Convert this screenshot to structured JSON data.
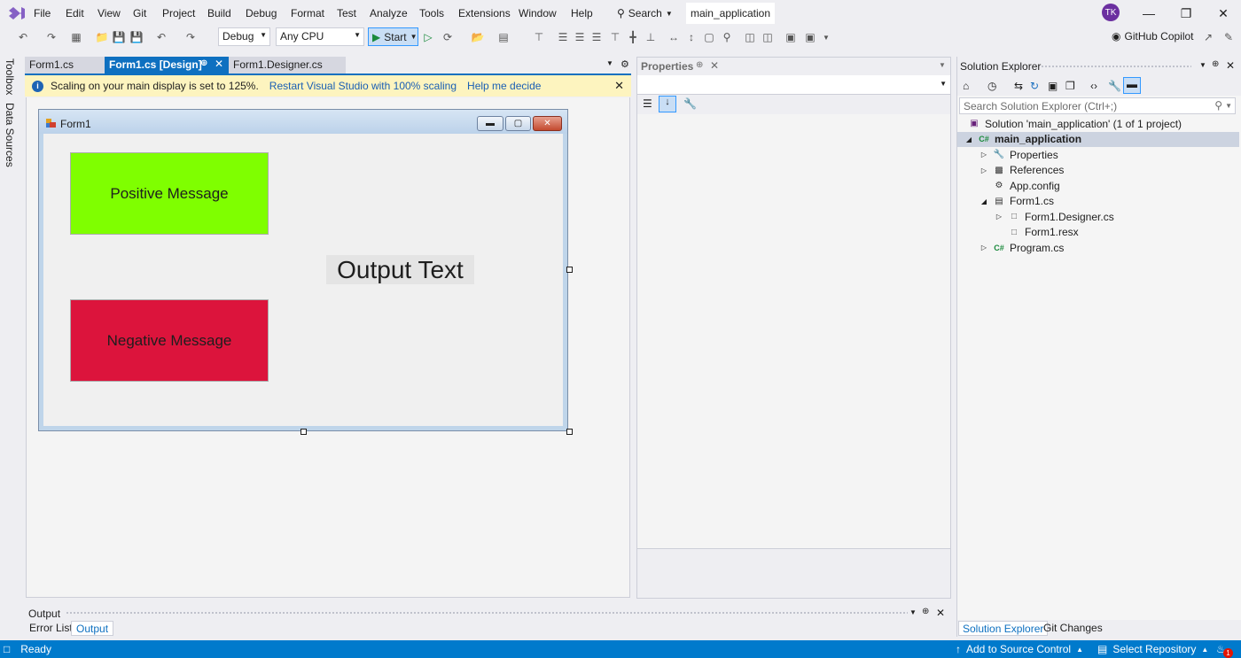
{
  "menu": {
    "items": [
      "File",
      "Edit",
      "View",
      "Git",
      "Project",
      "Build",
      "Debug",
      "Format",
      "Test",
      "Analyze",
      "Tools",
      "Extensions",
      "Window",
      "Help"
    ],
    "search_label": "Search",
    "solution_name": "main_application",
    "avatar_initials": "TK"
  },
  "toolbar": {
    "config": "Debug",
    "platform": "Any CPU",
    "start_label": "Start",
    "copilot_label": "GitHub Copilot"
  },
  "sidebar": {
    "toolbox": "Toolbox",
    "data_sources": "Data Sources"
  },
  "doc_tabs": [
    {
      "label": "Form1.cs",
      "active": false
    },
    {
      "label": "Form1.cs [Design]",
      "active": true
    },
    {
      "label": "Form1.Designer.cs",
      "active": false
    }
  ],
  "info_bar": {
    "message": "Scaling on your main display is set to 125%.",
    "link1": "Restart Visual Studio with 100% scaling",
    "link2": "Help me decide"
  },
  "form": {
    "title": "Form1",
    "positive_button": "Positive Message",
    "negative_button": "Negative Message",
    "output_label": "Output Text",
    "positive_color": "#7fff00",
    "negative_color": "#dc143c"
  },
  "properties": {
    "title": "Properties"
  },
  "solution_explorer": {
    "title": "Solution Explorer",
    "search_placeholder": "Search Solution Explorer (Ctrl+;)",
    "tree": [
      {
        "label": "Solution 'main_application' (1 of 1 project)",
        "icon": "solution-icon",
        "indent": 0,
        "expander": "",
        "selected": false,
        "bold": false
      },
      {
        "label": "main_application",
        "icon": "csharp-project-icon",
        "indent": 0,
        "expander": "expanded",
        "selected": true,
        "bold": true
      },
      {
        "label": "Properties",
        "icon": "wrench-icon",
        "indent": 1,
        "expander": "collapsed",
        "selected": false,
        "bold": false
      },
      {
        "label": "References",
        "icon": "references-icon",
        "indent": 1,
        "expander": "collapsed",
        "selected": false,
        "bold": false
      },
      {
        "label": "App.config",
        "icon": "config-file-icon",
        "indent": 1,
        "expander": "",
        "selected": false,
        "bold": false
      },
      {
        "label": "Form1.cs",
        "icon": "form-icon",
        "indent": 1,
        "expander": "expanded",
        "selected": false,
        "bold": false
      },
      {
        "label": "Form1.Designer.cs",
        "icon": "file-icon",
        "indent": 2,
        "expander": "collapsed",
        "selected": false,
        "bold": false
      },
      {
        "label": "Form1.resx",
        "icon": "file-icon",
        "indent": 2,
        "expander": "",
        "selected": false,
        "bold": false
      },
      {
        "label": "Program.cs",
        "icon": "csharp-file-icon",
        "indent": 1,
        "expander": "collapsed",
        "selected": false,
        "bold": false
      }
    ],
    "tabs": [
      "Solution Explorer",
      "Git Changes"
    ]
  },
  "output_panel": {
    "title": "Output",
    "tabs": [
      "Error List",
      "Output"
    ]
  },
  "status": {
    "ready": "Ready",
    "source_control": "Add to Source Control",
    "repository": "Select Repository",
    "notification_count": "1"
  }
}
